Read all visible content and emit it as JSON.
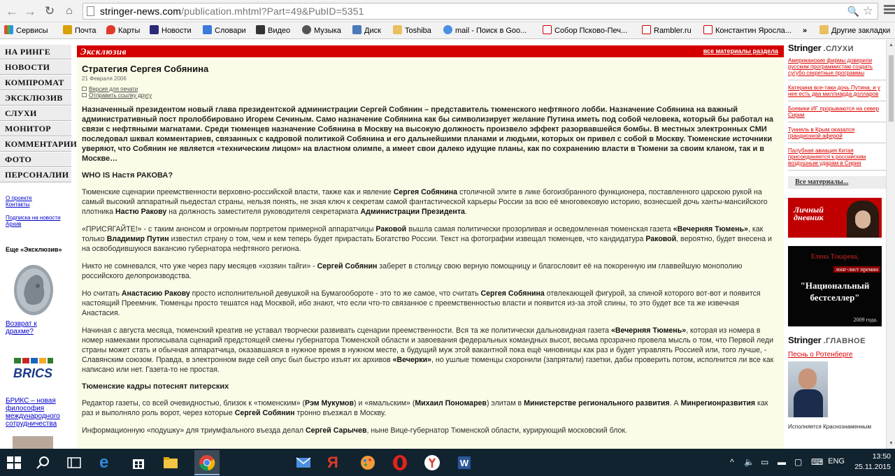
{
  "browser": {
    "url_host": "stringer-news.com",
    "url_path": "/publication.mhtml?Part=49&PubID=5351",
    "bookmarks": [
      {
        "label": "Сервисы",
        "color": "#e04b2a"
      },
      {
        "label": "Почта",
        "color": "#d8a000"
      },
      {
        "label": "Карты",
        "color": "#e03a2a"
      },
      {
        "label": "Новости",
        "color": "#2a2a7a"
      },
      {
        "label": "Словари",
        "color": "#3a7ad8"
      },
      {
        "label": "Видео",
        "color": "#333333"
      },
      {
        "label": "Музыка",
        "color": "#555555"
      },
      {
        "label": "Диск",
        "color": "#4a7ab8"
      },
      {
        "label": "Toshiba",
        "color": "#e8c060"
      },
      {
        "label": "mail - Поиск в Goo...",
        "color": "#4a90e2"
      },
      {
        "label": "Собор Псково-Печ...",
        "color": "#cc0000"
      },
      {
        "label": "Rambler.ru",
        "color": "#cc0000"
      },
      {
        "label": "Константин Яросла...",
        "color": "#cc0000"
      }
    ],
    "bookmarks_more": "»",
    "other_bookmarks": "Другие закладки"
  },
  "leftnav": {
    "items": [
      "НА РИНГЕ",
      "НОВОСТИ",
      "КОМПРОМАТ",
      "ЭКСКЛЮЗИВ",
      "СЛУХИ",
      "МОНИТОР",
      "КОММЕНТАРИИ",
      "ФОТО",
      "ПЕРСОНАЛИИ"
    ],
    "links": [
      "О проекте",
      "Контакты",
      "Подписка на новости",
      "Архив"
    ],
    "more_title": "Еще «Эксклюзив»",
    "coin_caption": "Возврат к драхме?",
    "brics_caption": "БРИКС – новая философия международного сотрудничества"
  },
  "main": {
    "section": "Эксклюзив",
    "all_link": "все материалы раздела",
    "title": "Стратегия Сергея Собянина",
    "date": "21 Февраля 2006",
    "print_link": "Версия для печати",
    "send_link": "Отправить ссылку другу",
    "lead": "Назначенный президентом новый глава президентской администрации Сергей Собянин – представитель тюменского нефтяного лобби. Назначение Собянина на важный административный пост пролоббировано Игорем Сечиным. Само назначение Собянина как бы символизирует желание Путина иметь под собой человека, который бы работал на связи с нефтяными магнатами. Среди тюменцев назначение Собянина в Москву на высокую должность произвело эффект разорвавшейся бомбы. В местных электронных СМИ последовал шквал комментариев, связанных с кадровой политикой Собянина и его дальнейшими планами и людьми, которых он привел с собой в Москву. Тюменские источники уверяют, что Собянин не является «техническим лицом» на властном олимпе, а имеет свои далеко идущие планы, как по сохранению власти в Тюмени за своим кланом, так и в Москве…",
    "sub1": "WHO IS Настя РАКОВА?",
    "p1": "Тюменские сценарии преемственности верховно-российской власти, также как и явление <b>Сергея Собянина</b> столичной элите в лике богоизбранного функционера, поставленного царскою рукой на самый высокий аппаратный пьедестал страны, нельзя понять, не зная ключ к секретам самой фантастической карьеры России за всю её многовековую историю, вознесшей дочь ханты-мансийского плотника <b>Настю Ракову</b> на должность заместителя руководителя секретариата <b>Администрации Президента</b>.",
    "p2": "«ПРИСЯГАЙТЕ!» - с таким анонсом и огромным портретом примерной аппаратчицы <b>Раковой</b> вышла самая политически прозорливая и осведомленная тюменская газета <b>«Вечерняя Тюмень»</b>, как только <b>Владимир Путин</b> известил страну о том, чем и кем теперь будет прирастать Богатство России. Текст на фотографии извещал тюменцев, что кандидатура <b>Раковой</b>, вероятно, будет внесена и на освободившуюся вакансию губернатора нефтяного региона.",
    "p3": "Никто не сомневался, что уже через пару месяцев «хозяин тайги» - <b>Сергей Собянин</b> заберет в столицу свою верную помощницу и благословит её на покоренную им главвейшую монополию российского делопроизводства.",
    "p4": "Но считать <b>Анастасию Ракову</b> просто исполнительной девушкой на Бумагообороте - это то же самое, что считать <b>Сергея Собянина</b> отвлекающей фигурой, за спиной которого вот-вот и появится настоящий Преемник. Тюменцы просто тешатся над Москвой, ибо знают, что если что-то связанное с преемственностью власти и появится из-за этой спины, то это будет все та же извечная Анастасия.",
    "p5": "Начиная с августа месяца, тюменский креатив не уставал творчески развивать сценарии преемственности. Вся та же политически дальновидная газета <b>«Вечерняя Тюмень»</b>, которая из номера в номер намеками прописывала сценарий предстоящей смены губернатора Тюменской области и завоевания федеральных командных высот, весьма прозрачно провела мысль о том, что Первой леди страны может стать и обычная аппаратчица, оказавшаяся в нужное время в нужном месте, а будущий муж этой вакантной пока ещё чиновницы как раз и будет управлять Россией или, того лучше, - Славянским союзом. Правда, в электронном виде сей опус был быстро изъят их архивов <b>«Вечерки»</b>, но ушлые тюменцы схоронили (запрятали) газетки, дабы проверить потом, исполнится ли все как написано или нет. Газета-то не простая.",
    "sub2": "Тюменские кадры потеснят питерских",
    "p6": "Редактор газеты, со всей очевидностью, близок к «тюменским» (<b>Рэм Мукумов</b>) и «ямальским» (<b>Михаил Пономарев</b>) элитам в <b>Министерстве регионального развития</b>. А <b>Минрегионразвития</b> как раз и выполняло роль ворот, через которые <b>Сергей Собянин</b> тронно въезжал в Москву.",
    "p7": "Информационную «подушку» для триумфального въезда делал <b>Сергей Сарычев</b>, ныне Вице-губернатор Тюменской области, курирующий московский блок."
  },
  "right": {
    "brand": "Stringer",
    "rumors_sub": ".СЛУХИ",
    "rumors": [
      "Американские фирмы доверили русским программистам создать сугубо секретные программы",
      "Катерина все-таки дочь Путина, и у нее есть два миллиарда долларов",
      "Боевики ИГ прорываются на север Сирии",
      "Туннель в Крым оказался грандиозной аферой",
      "Палубная авиация Китая присоединяется к российским воздушным ударам в Сирии"
    ],
    "all_materials": "Все материалы...",
    "diary_line1": "Личный",
    "diary_line2": "дневник",
    "book_author": "Елена Токарева,",
    "book_long": "лонг-лист премии",
    "book_prize1": "\"Национальный",
    "book_prize2": "бестселлер\"",
    "book_year": "2009 года.",
    "main_sub": ".ГЛАВНОЕ",
    "main_link": "Песнь о Ротенберге",
    "main_caption": "Исполняется Краснознаменным"
  },
  "taskbar": {
    "lang": "ENG",
    "time": "13:50",
    "date": "25.11.2015"
  }
}
